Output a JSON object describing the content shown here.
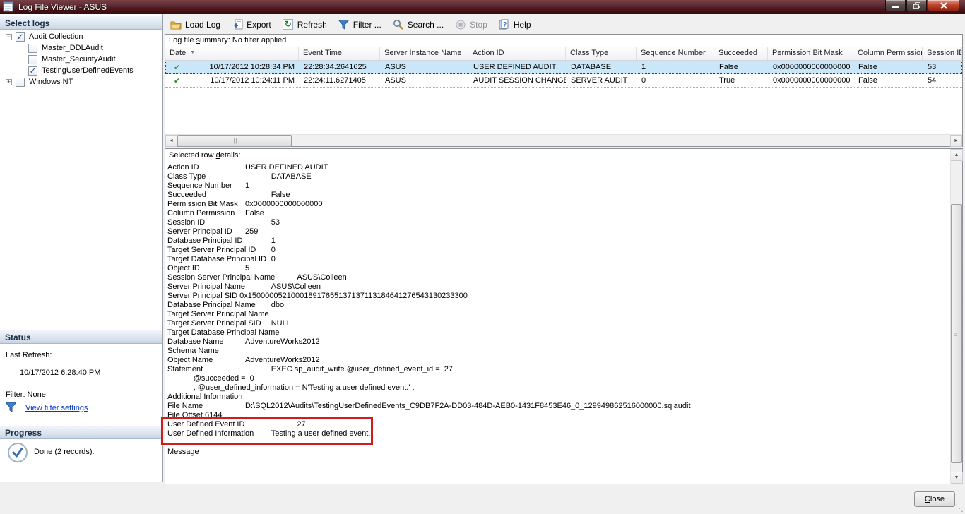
{
  "window": {
    "title": "Log File Viewer - ASUS"
  },
  "colors": {
    "titlebar_maroon": "#471418",
    "selection_blue": "#c9e7f8",
    "link_blue": "#0535cc",
    "highlight_red": "#cf1d1d",
    "row_check_green": "#2f8f2f"
  },
  "icons": {
    "sort_indicator": "▼",
    "row_check": "✔",
    "checkbox_check": "✓",
    "expander_collapse": "−",
    "expander_expand": "+",
    "scroll_left": "◄",
    "scroll_right": "►",
    "scroll_up": "▲",
    "scroll_down": "▼",
    "hthumb_grip": "|||",
    "vthumb_grip": "≡",
    "resize_grip": "⋱",
    "refresh_glyph": "↻"
  },
  "sidebar": {
    "select_logs_header": "Select logs",
    "tree": [
      {
        "label": "Audit Collection"
      },
      {
        "label": "Master_DDLAudit"
      },
      {
        "label": "Master_SecurityAudit"
      },
      {
        "label": "TestingUserDefinedEvents"
      },
      {
        "label": "Windows NT"
      }
    ],
    "status_header": "Status",
    "last_refresh_label": "Last Refresh:",
    "last_refresh_value": "10/17/2012 6:28:40 PM",
    "filter_label": "Filter: None",
    "view_filter_link": "View filter settings",
    "progress_header": "Progress",
    "progress_status": "Done (2 records)."
  },
  "toolbar": {
    "buttons": [
      {
        "label": "Load Log",
        "icon": "folder-open-icon"
      },
      {
        "label": "Export",
        "icon": "export-icon"
      },
      {
        "label": "Refresh",
        "icon": "refresh-icon"
      },
      {
        "label": "Filter ...",
        "icon": "filter-funnel-icon"
      },
      {
        "label": "Search ...",
        "icon": "search-icon"
      },
      {
        "label": "Stop",
        "icon": "stop-icon"
      },
      {
        "label": "Help",
        "icon": "help-icon"
      }
    ]
  },
  "grid": {
    "summary_pre": "Log file ",
    "summary_u": "s",
    "summary_post": "ummary: No filter applied",
    "columns": [
      "Date",
      "Event Time",
      "Server Instance Name",
      "Action ID",
      "Class Type",
      "Sequence Number",
      "Succeeded",
      "Permission Bit Mask",
      "Column Permission",
      "Session ID"
    ],
    "rows": [
      {
        "cells": [
          "10/17/2012 10:28:34 PM",
          "22:28:34.2641625",
          "ASUS",
          "USER DEFINED AUDIT",
          "DATABASE",
          "1",
          "False",
          "0x0000000000000000",
          "False",
          "53"
        ]
      },
      {
        "cells": [
          "10/17/2012 10:24:11 PM",
          "22:24:11.6271405",
          "ASUS",
          "AUDIT SESSION CHANGED",
          "SERVER AUDIT",
          "0",
          "True",
          "0x0000000000000000",
          "False",
          "54"
        ]
      }
    ]
  },
  "details": {
    "title_pre": "Selected row ",
    "title_u": "d",
    "title_post": "etails:",
    "lines": [
      "Action ID\t\tUSER DEFINED AUDIT",
      "Class Type\t\t\tDATABASE",
      "Sequence Number\t1",
      "Succeeded\t\t\tFalse",
      "Permission Bit Mask\t0x0000000000000000",
      "Column Permission\tFalse",
      "Session ID\t\t\t53",
      "Server Principal ID\t259",
      "Database Principal ID\t\t1",
      "Target Server Principal ID\t0",
      "Target Database Principal ID\t0",
      "Object ID\t\t5",
      "Session Server Principal Name\tASUS\\Colleen",
      "Server Principal Name\tASUS\\Colleen",
      "Server Principal SID 0x150000052100018917655137137113184641276543130233300",
      "Database Principal Name\tdbo",
      "Target Server Principal Name",
      "Target Server Principal SID\tNULL",
      "Target Database Principal Name",
      "Database Name\tAdventureWorks2012",
      "Schema Name",
      "Object Name\t\tAdventureWorks2012",
      "Statement\t\t\tEXEC sp_audit_write @user_defined_event_id =  27 ,",
      "\t@succeeded =  0",
      "\t, @user_defined_information = N'Testing a user defined event.' ;",
      "Additional Information",
      "File Name\t\tD:\\SQL2012\\Audits\\TestingUserDefinedEvents_C9DB7F2A-DD03-484D-AEB0-1431F8453E46_0_129949862516000000.sqlaudit",
      "File Offset 6144",
      "User Defined Event ID\t\t27",
      "User Defined Information\tTesting a user defined event."
    ],
    "message_label": "Message"
  },
  "footer": {
    "close_u": "C",
    "close_post": "lose"
  }
}
